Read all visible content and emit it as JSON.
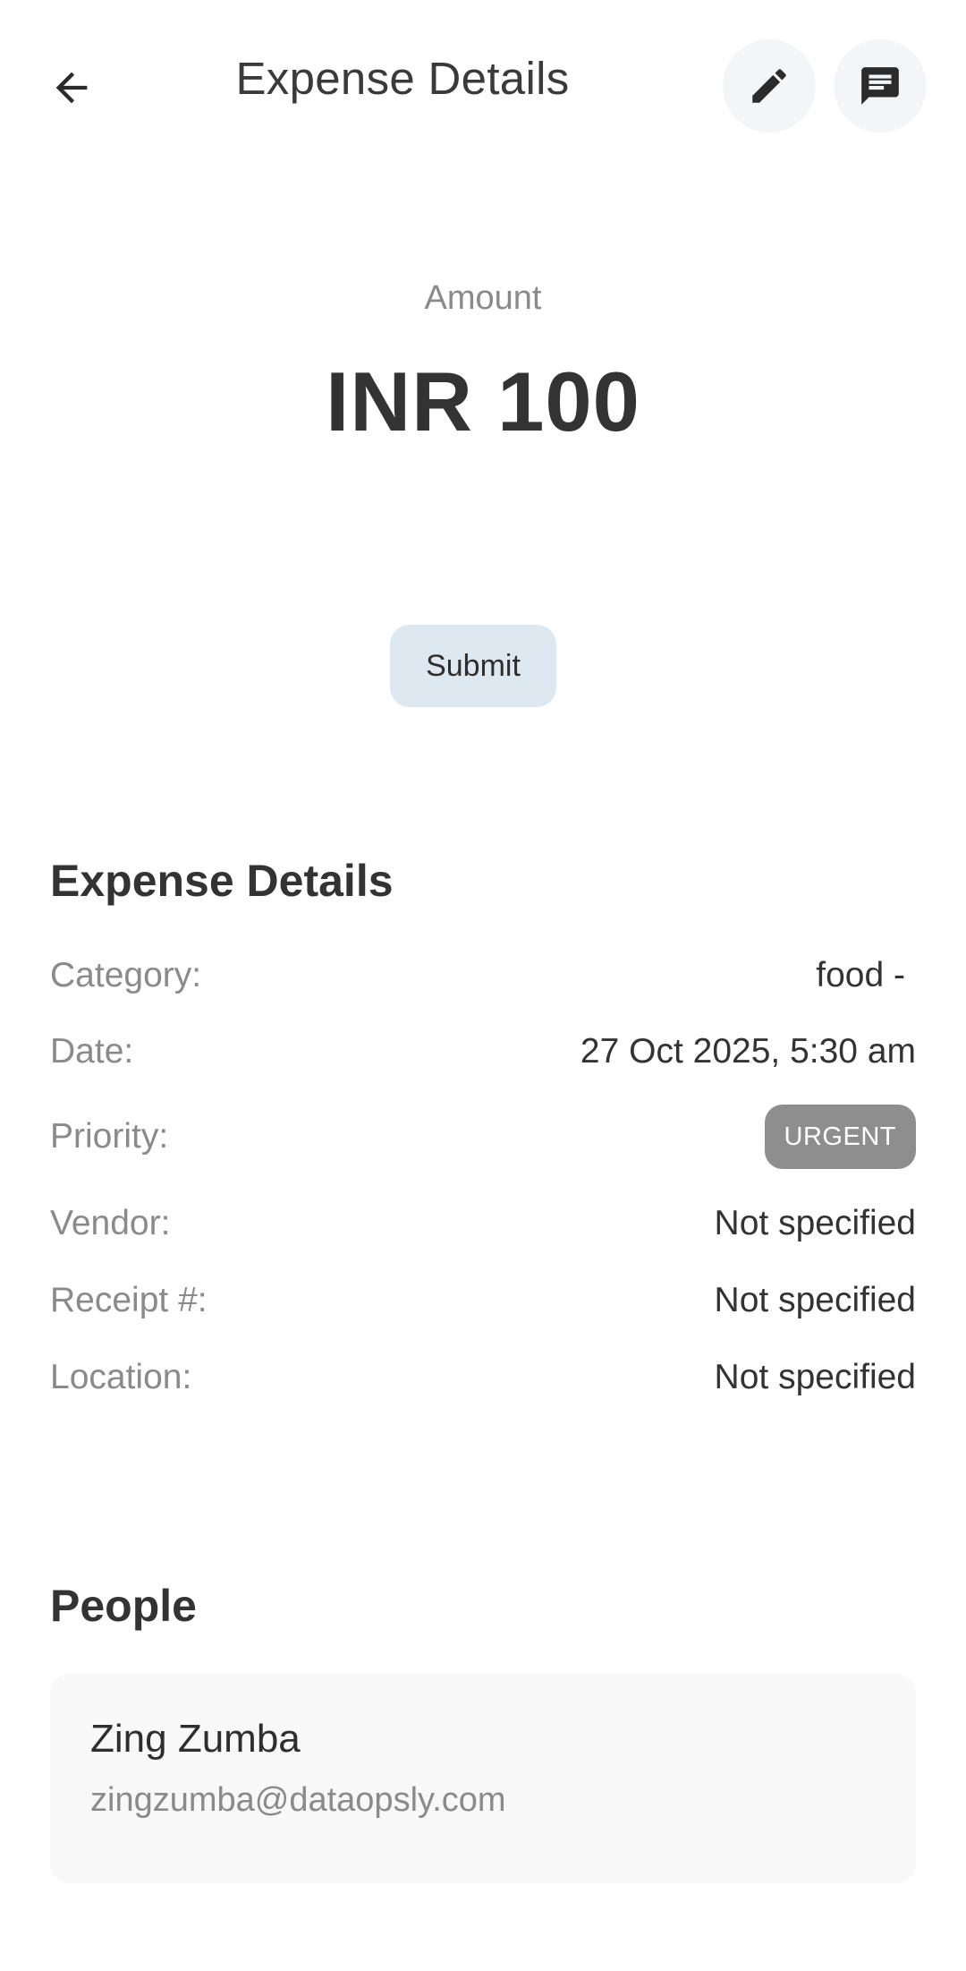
{
  "header": {
    "title": "Expense Details",
    "back_icon": "arrow-back-icon",
    "edit_icon": "pencil-icon",
    "comment_icon": "chat-bubble-icon"
  },
  "amount": {
    "label": "Amount",
    "value": "INR 100"
  },
  "actions": {
    "submit_label": "Submit"
  },
  "details": {
    "title": "Expense Details",
    "rows": [
      {
        "label": "Category:",
        "value": "food -"
      },
      {
        "label": "Date:",
        "value": "27 Oct 2025, 5:30 am"
      },
      {
        "label": "Priority:",
        "value": "URGENT"
      },
      {
        "label": "Vendor:",
        "value": "Not specified"
      },
      {
        "label": "Receipt #:",
        "value": "Not specified"
      },
      {
        "label": "Location:",
        "value": "Not specified"
      }
    ]
  },
  "people": {
    "title": "People",
    "items": [
      {
        "name": "Zing Zumba",
        "email": "zingzumba@dataopsly.com"
      }
    ]
  },
  "colors": {
    "submit_bg": "#dde8f0",
    "badge_bg": "#8e8e8e",
    "icon_btn_bg": "#f4f5f6",
    "card_bg": "#f8f8f8"
  }
}
